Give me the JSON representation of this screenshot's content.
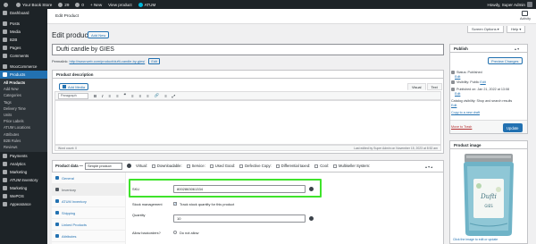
{
  "adminbar": {
    "site_name": "Your Book Store",
    "updates_count": "29",
    "comments_count": "0",
    "new_label": "New",
    "view_product": "View product",
    "plugin": "ATUM",
    "howdy": "Howdy, Super Admin"
  },
  "sidebar": {
    "items": [
      {
        "label": "Dashboard"
      },
      {
        "label": "Posts"
      },
      {
        "label": "Media"
      },
      {
        "label": "B2B"
      },
      {
        "label": "Pages"
      },
      {
        "label": "Comments"
      },
      {
        "label": "WooCommerce"
      },
      {
        "label": "Products"
      }
    ],
    "submenu": [
      "All Products",
      "Add New",
      "Categories",
      "Tags",
      "Delivery Time",
      "Units",
      "Price Labels",
      "ATUM Locations",
      "Attributes",
      "B2B Rules",
      "Reviews"
    ],
    "bottom_items": [
      {
        "label": "Payments"
      },
      {
        "label": "Analytics"
      },
      {
        "label": "Marketing"
      },
      {
        "label": "ATUM Inventory"
      },
      {
        "label": "Marketing"
      },
      {
        "label": "WePOS"
      },
      {
        "label": "Appearance"
      }
    ]
  },
  "topstrip": {
    "breadcrumb": "Edit Product",
    "activity": "Activity"
  },
  "screen_options": "Screen Options ▾",
  "help": "Help ▾",
  "page": {
    "title": "Edit product",
    "add_new": "Add New",
    "product_title": "Dufti candle by GIES",
    "permalink_label": "Permalink:",
    "permalink_url": "http://www.web.com/product/dufti-candle-by-gies/",
    "permalink_edit": "Edit"
  },
  "description": {
    "header": "Product description",
    "add_media": "Add Media",
    "tab_visual": "Visual",
    "tab_text": "Text",
    "paragraph": "Paragraph",
    "toolbar_buttons": [
      "B",
      "I",
      "≡",
      "≡",
      "❝",
      "≡",
      "≡",
      "≡",
      "🔗",
      "≡",
      "⤢"
    ],
    "word_count": "Word count: 0",
    "last_edited": "Last edited by Super Admin on November 15, 2023 at 8:52 am"
  },
  "product_data": {
    "label": "Product data —",
    "type": "Simple product",
    "options": [
      "Virtual:",
      "Downloadable:",
      "Service:",
      "Used Good:",
      "Defective Copy:",
      "Differential taxed:",
      "Cool:",
      "Multiseller System:"
    ],
    "tabs": [
      "General",
      "Inventory",
      "ATUM Inventory",
      "Shipping",
      "Linked Products",
      "Attributes"
    ],
    "active_tab": "Inventory",
    "sku_label": "SKU",
    "sku_value": "8002863061334",
    "stock_mgmt_label": "Stock management",
    "stock_mgmt_text": "Track stock quantity for this product",
    "quantity_label": "Quantity",
    "quantity_value": "10",
    "backorders_label": "Allow backorders?",
    "backorders_option": "Do not allow"
  },
  "publish": {
    "header": "Publish",
    "preview_changes": "Preview Changes",
    "status": "Status: Published",
    "status_edit": "Edit",
    "visibility": "Visibility: Public",
    "visibility_edit": "Edit",
    "published_on": "Published on: Jan 21, 2022 at 13:08",
    "published_edit": "Edit",
    "catalog": "Catalog visibility: Shop and search results",
    "catalog_edit": "Edit",
    "copy_draft": "Copy to a new draft",
    "trash": "Move to Trash",
    "update": "Update"
  },
  "product_image": {
    "header": "Product image",
    "note": "Click the image to edit or update",
    "jar_brand": "Dufti",
    "jar_sub": "GIES"
  }
}
